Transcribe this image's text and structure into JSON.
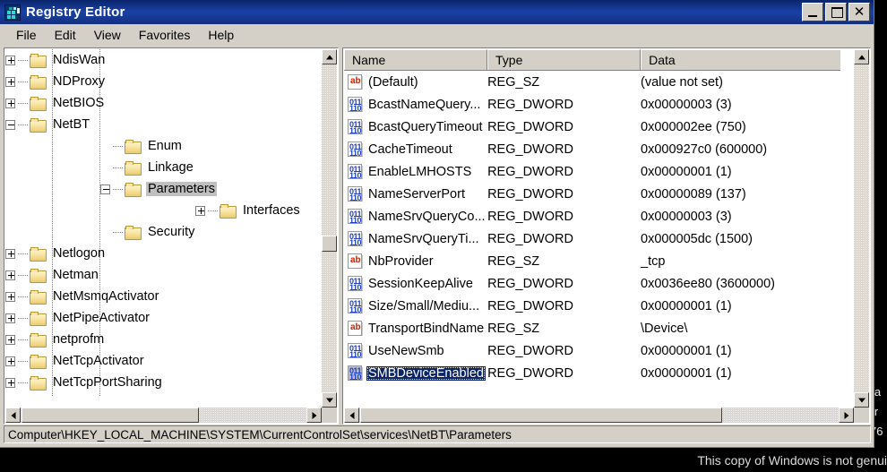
{
  "window": {
    "title": "Registry Editor",
    "icon": "registry-editor-icon",
    "controls": {
      "minimize": "_",
      "maximize": "□",
      "close": "✕"
    }
  },
  "menubar": {
    "items": [
      {
        "label": "File"
      },
      {
        "label": "Edit"
      },
      {
        "label": "View"
      },
      {
        "label": "Favorites"
      },
      {
        "label": "Help"
      }
    ]
  },
  "tree": {
    "nodes": [
      {
        "label": "NdisWan",
        "indent": 0,
        "toggle": "plus",
        "selected": false
      },
      {
        "label": "NDProxy",
        "indent": 0,
        "toggle": "plus",
        "selected": false
      },
      {
        "label": "NetBIOS",
        "indent": 0,
        "toggle": "plus",
        "selected": false
      },
      {
        "label": "NetBT",
        "indent": 0,
        "toggle": "minus",
        "selected": false
      },
      {
        "label": "Enum",
        "indent": 1,
        "toggle": "none",
        "selected": false
      },
      {
        "label": "Linkage",
        "indent": 1,
        "toggle": "none",
        "selected": false
      },
      {
        "label": "Parameters",
        "indent": 1,
        "toggle": "minus",
        "selected": true
      },
      {
        "label": "Interfaces",
        "indent": 2,
        "toggle": "plus",
        "selected": false
      },
      {
        "label": "Security",
        "indent": 1,
        "toggle": "none",
        "selected": false
      },
      {
        "label": "Netlogon",
        "indent": 0,
        "toggle": "plus",
        "selected": false
      },
      {
        "label": "Netman",
        "indent": 0,
        "toggle": "plus",
        "selected": false
      },
      {
        "label": "NetMsmqActivator",
        "indent": 0,
        "toggle": "plus",
        "selected": false
      },
      {
        "label": "NetPipeActivator",
        "indent": 0,
        "toggle": "plus",
        "selected": false
      },
      {
        "label": "netprofm",
        "indent": 0,
        "toggle": "plus",
        "selected": false
      },
      {
        "label": "NetTcpActivator",
        "indent": 0,
        "toggle": "plus",
        "selected": false
      },
      {
        "label": "NetTcpPortSharing",
        "indent": 0,
        "toggle": "plus",
        "selected": false
      }
    ]
  },
  "list": {
    "columns": [
      {
        "label": "Name"
      },
      {
        "label": "Type"
      },
      {
        "label": "Data"
      }
    ],
    "rows": [
      {
        "name": "(Default)",
        "type": "REG_SZ",
        "data": "(value not set)",
        "icon": "string-value-icon",
        "selected": false
      },
      {
        "name": "BcastNameQuery...",
        "type": "REG_DWORD",
        "data": "0x00000003 (3)",
        "icon": "dword-value-icon",
        "selected": false
      },
      {
        "name": "BcastQueryTimeout",
        "type": "REG_DWORD",
        "data": "0x000002ee (750)",
        "icon": "dword-value-icon",
        "selected": false
      },
      {
        "name": "CacheTimeout",
        "type": "REG_DWORD",
        "data": "0x000927c0 (600000)",
        "icon": "dword-value-icon",
        "selected": false
      },
      {
        "name": "EnableLMHOSTS",
        "type": "REG_DWORD",
        "data": "0x00000001 (1)",
        "icon": "dword-value-icon",
        "selected": false
      },
      {
        "name": "NameServerPort",
        "type": "REG_DWORD",
        "data": "0x00000089 (137)",
        "icon": "dword-value-icon",
        "selected": false
      },
      {
        "name": "NameSrvQueryCo...",
        "type": "REG_DWORD",
        "data": "0x00000003 (3)",
        "icon": "dword-value-icon",
        "selected": false
      },
      {
        "name": "NameSrvQueryTi...",
        "type": "REG_DWORD",
        "data": "0x000005dc (1500)",
        "icon": "dword-value-icon",
        "selected": false
      },
      {
        "name": "NbProvider",
        "type": "REG_SZ",
        "data": "_tcp",
        "icon": "string-value-icon",
        "selected": false
      },
      {
        "name": "SessionKeepAlive",
        "type": "REG_DWORD",
        "data": "0x0036ee80 (3600000)",
        "icon": "dword-value-icon",
        "selected": false
      },
      {
        "name": "Size/Small/Mediu...",
        "type": "REG_DWORD",
        "data": "0x00000001 (1)",
        "icon": "dword-value-icon",
        "selected": false
      },
      {
        "name": "TransportBindName",
        "type": "REG_SZ",
        "data": "\\Device\\",
        "icon": "string-value-icon",
        "selected": false
      },
      {
        "name": "UseNewSmb",
        "type": "REG_DWORD",
        "data": "0x00000001 (1)",
        "icon": "dword-value-icon",
        "selected": false
      },
      {
        "name": "SMBDeviceEnabled",
        "type": "REG_DWORD",
        "data": "0x00000001 (1)",
        "icon": "dword-value-icon",
        "selected": true
      }
    ]
  },
  "statusbar": {
    "path": "Computer\\HKEY_LOCAL_MACHINE\\SYSTEM\\CurrentControlSet\\services\\NetBT\\Parameters"
  },
  "desktop": {
    "watermark": "This copy of Windows is not genui",
    "fragments": [
      "la",
      "ir",
      "76"
    ]
  },
  "colors": {
    "titlebar_start": "#0a246a",
    "titlebar_end": "#14307f",
    "face": "#d4d0c8",
    "selection": "#0a246a",
    "tree_selection": "#c0c0c0",
    "string_icon": "#cc2200",
    "dword_icon": "#1a3fcc"
  }
}
